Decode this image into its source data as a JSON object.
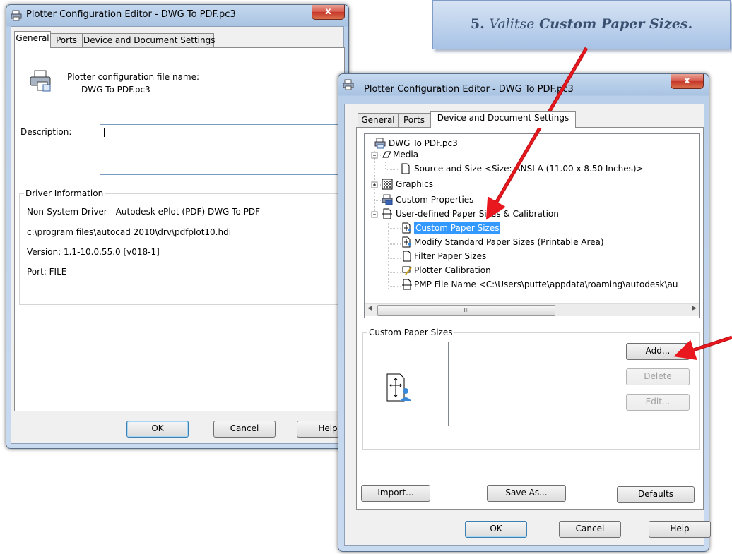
{
  "callout": {
    "step": "5.",
    "prefix": "Valitse",
    "emphasis": "Custom Paper Sizes."
  },
  "window1": {
    "title": "Plotter Configuration Editor - DWG To PDF.pc3",
    "close_label": "x",
    "tabs": [
      "General",
      "Ports",
      "Device and Document Settings"
    ],
    "file_name_label": "Plotter configuration file name:",
    "file_name": "DWG To PDF.pc3",
    "description_label": "Description:",
    "description_value": "",
    "driver_info_label": "Driver Information",
    "driver_name": "Non-System Driver - Autodesk ePlot (PDF) DWG To PDF",
    "driver_path": "c:\\program files\\autocad 2010\\drv\\pdfplot10.hdi",
    "version": "Version: 1.1-10.0.55.0 [v018-1]",
    "port": "Port: FILE",
    "ok_label": "OK",
    "cancel_label": "Cancel",
    "help_label": "Help"
  },
  "window2": {
    "title": "Plotter Configuration Editor - DWG To PDF.pc3",
    "close_label": "x",
    "tabs": [
      "General",
      "Ports",
      "Device and Document Settings"
    ],
    "tree": {
      "root": "DWG To PDF.pc3",
      "media": "Media",
      "source_size": "Source and Size <Size: ANSI A (11.00 x 8.50 Inches)>",
      "graphics": "Graphics",
      "custom_properties": "Custom Properties",
      "user_defined": "User-defined Paper Sizes & Calibration",
      "custom_paper_sizes": "Custom Paper Sizes",
      "modify_standard": "Modify Standard Paper Sizes (Printable Area)",
      "filter_paper": "Filter Paper Sizes",
      "plotter_calibration": "Plotter Calibration",
      "pmp_file": "PMP File Name <C:\\Users\\putte\\appdata\\roaming\\autodesk\\au"
    },
    "scroll_thumb_label": "III",
    "group_label": "Custom Paper Sizes",
    "add_label": "Add...",
    "delete_label": "Delete",
    "edit_label": "Edit...",
    "import_label": "Import...",
    "save_as_label": "Save As...",
    "defaults_label": "Defaults",
    "ok_label": "OK",
    "cancel_label": "Cancel",
    "help_label": "Help"
  },
  "colors": {
    "arrow": "#e8181e",
    "selection": "#3399ff",
    "callout_text": "#3a5070"
  }
}
